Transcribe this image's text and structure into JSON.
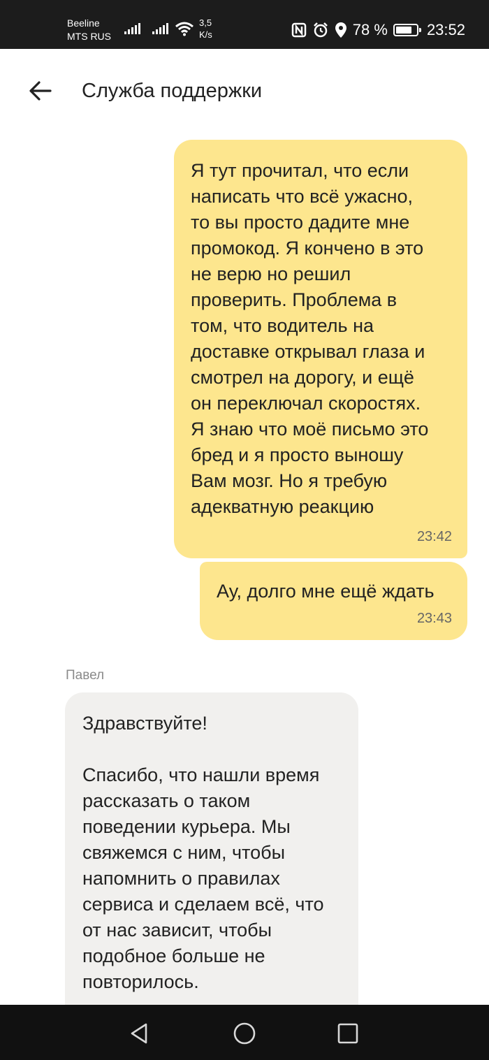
{
  "status_bar": {
    "carrier1": "Beeline",
    "carrier2": "MTS RUS",
    "speed_value": "3,5",
    "speed_unit": "K/s",
    "battery_level": "78 %",
    "battery_fraction": 0.78,
    "time": "23:52",
    "icons": [
      "signal-icon",
      "signal-icon",
      "wifi-icon",
      "nfc-icon",
      "alarm-icon",
      "location-icon",
      "battery-icon"
    ]
  },
  "header": {
    "back_icon": "arrow-left-icon",
    "title": "Служба поддержки"
  },
  "messages": [
    {
      "direction": "outgoing",
      "lines": [
        "Я тут прочитал, что если",
        "написать что всё ужасно,",
        "то вы просто дадите мне",
        "промокод. Я кончено в это",
        "не верю но решил",
        "проверить. Проблема в",
        "том, что водитель на",
        "доставке открывал глаза и",
        "смотрел на дорогу, и ещё",
        "он переключал скоростях.",
        "Я знаю что моё письмо это",
        "бред и я просто выношу",
        "Вам мозг. Но я требую",
        "адекватную реакцию"
      ],
      "time": "23:42"
    },
    {
      "direction": "outgoing",
      "lines": [
        "Ау, долго мне ещё ждать"
      ],
      "time": "23:43"
    },
    {
      "direction": "incoming",
      "sender": "Павел",
      "greeting": "Здравствуйте!",
      "lines": [
        "Спасибо, что нашли время",
        "рассказать о таком",
        "поведении курьера. Мы",
        "свяжемся с ним, чтобы",
        "напомнить о правилах",
        "сервиса и сделаем всё, что",
        "от нас зависит, чтобы",
        "подобное больше не",
        "повторилось."
      ]
    }
  ],
  "nav_bar": {
    "buttons": [
      "back-triangle-icon",
      "home-circle-icon",
      "recents-square-icon"
    ]
  }
}
